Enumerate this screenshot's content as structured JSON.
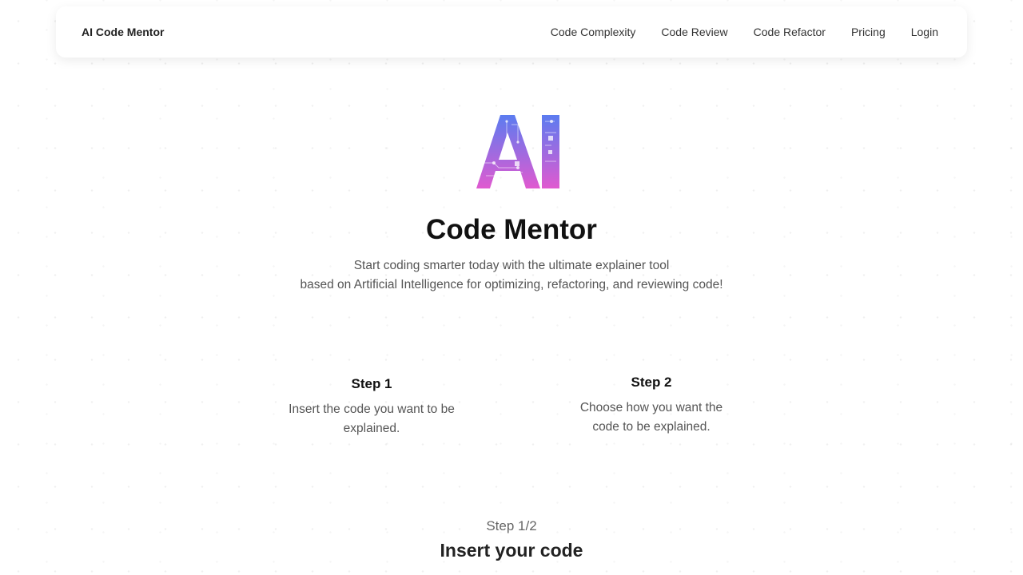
{
  "navbar": {
    "brand": "AI Code Mentor",
    "links": [
      "Code Complexity",
      "Code Review",
      "Code Refactor",
      "Pricing",
      "Login"
    ]
  },
  "hero": {
    "logo_text": "AI",
    "title": "Code Mentor",
    "subtitle_line1": "Start coding smarter today with the ultimate explainer tool",
    "subtitle_line2": "based on Artificial Intelligence for optimizing, refactoring, and reviewing code!"
  },
  "steps": [
    {
      "title": "Step 1",
      "description": "Insert the code you want to be explained."
    },
    {
      "title": "Step 2",
      "description": "Choose how you want the code to be explained."
    }
  ],
  "wizard": {
    "progress": "Step 1/2",
    "heading": "Insert your code"
  },
  "colors": {
    "logo_gradient_start": "#5b7cf0",
    "logo_gradient_end": "#e05ad0"
  }
}
